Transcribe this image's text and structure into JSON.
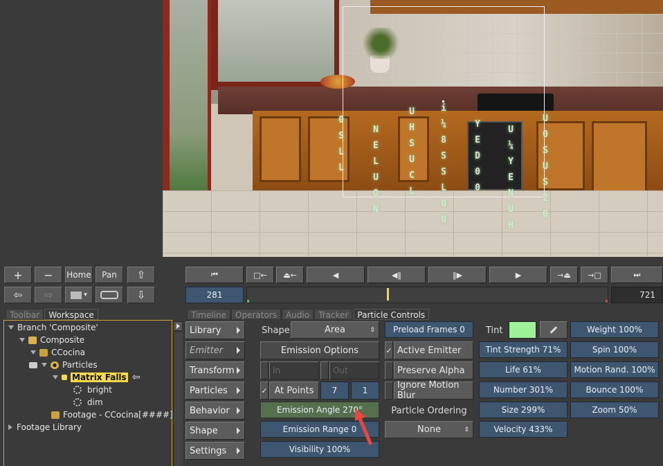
{
  "viewer_matrix_columns": [
    [
      "0",
      "S",
      "L",
      "L"
    ],
    [
      "N",
      "E",
      "L",
      "U",
      "O",
      "N"
    ],
    [
      "U",
      "H",
      "S",
      "U",
      "C",
      "L"
    ],
    [
      "i",
      "¼",
      "8",
      "S",
      "S",
      "L",
      "0",
      "0"
    ],
    [
      "Y",
      "E",
      "D",
      "0",
      "0"
    ],
    [
      "U",
      "¼",
      "Y",
      "E",
      "N",
      "U",
      "H"
    ],
    [
      "U",
      "0",
      "S",
      "U",
      "S",
      "2",
      "0"
    ]
  ],
  "toolbar": {
    "plus": "+",
    "minus": "−",
    "home": "Home",
    "pan": "Pan",
    "arrow_up": "⇧",
    "arrow_left": "⇦",
    "arrow_right": "⇨",
    "arrow_down": "⇩",
    "view_label": "▾"
  },
  "transport": {
    "first": "⏮",
    "mark_in": "□←",
    "goto_in": "⏏←",
    "prev": "◀",
    "step_back": "◀‖",
    "step_fwd": "‖▶",
    "play": "▶",
    "goto_out": "→⏏",
    "mark_out": "→□",
    "last": "⏭",
    "current_frame": "281",
    "end_frame": "721"
  },
  "left_tabs": [
    {
      "label": "Toolbar"
    },
    {
      "label": "Workspace"
    }
  ],
  "right_tabs": [
    {
      "label": "Timeline"
    },
    {
      "label": "Operators"
    },
    {
      "label": "Audio"
    },
    {
      "label": "Tracker"
    },
    {
      "label": "Particle Controls"
    }
  ],
  "tree": {
    "branch": "Branch 'Composite'",
    "composite": "Composite",
    "ccocina": "CCocina",
    "particles": "Particles",
    "matrix_falls": "Matrix Falls",
    "bright": "bright",
    "dim": "dim",
    "footage": "Footage - CCocina[####]",
    "footage_library": "Footage Library"
  },
  "categories": [
    {
      "label": "Library"
    },
    {
      "label": "Emitter"
    },
    {
      "label": "Transform"
    },
    {
      "label": "Particles"
    },
    {
      "label": "Behavior"
    },
    {
      "label": "Shape"
    },
    {
      "label": "Settings"
    }
  ],
  "emitter": {
    "shape_label": "Shape",
    "shape_value": "Area",
    "emission_options": "Emission Options",
    "in_label": "In",
    "out_label": "Out",
    "at_points": "At Points",
    "at_points_a": "7",
    "at_points_b": "1",
    "emission_angle": "Emission Angle 270°",
    "emission_range": "Emission Range 0",
    "visibility": "Visibility 100%"
  },
  "options": {
    "preload_frames": "Preload Frames 0",
    "active_emitter": "Active Emitter",
    "preserve_alpha": "Preserve Alpha",
    "ignore_motion_blur": "Ignore Motion Blur",
    "particle_ordering": "Particle Ordering",
    "ordering_value": "None"
  },
  "params": {
    "tint_label": "Tint",
    "tint_color": "#9ef29a",
    "tint_strength": "Tint Strength 71%",
    "life": "Life 61%",
    "number": "Number 301%",
    "size": "Size 299%",
    "velocity": "Velocity 433%",
    "weight": "Weight 100%",
    "spin": "Spin 100%",
    "motion_rand": "Motion Rand. 100%",
    "bounce": "Bounce 100%",
    "zoom": "Zoom 50%"
  },
  "colors": {
    "slider": "#3f5670",
    "accent_selected": "#f3d94c",
    "arrow_annotation": "#e8463f"
  }
}
